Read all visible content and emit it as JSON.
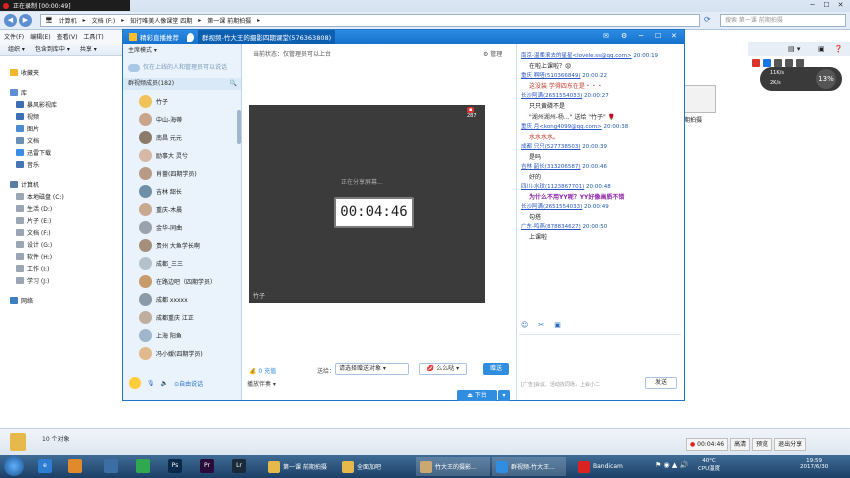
{
  "recorder": {
    "status": "正在录制 [00:00:49]"
  },
  "explorer": {
    "address": [
      "计算机",
      "文档 (F:)",
      "知行唯美人像课堂 四期",
      "第一课 前期拍摄"
    ],
    "search_placeholder": "搜索 第一课 前期拍摄",
    "menu": [
      "文件(F)",
      "编辑(E)",
      "查看(V)",
      "工具(T)"
    ],
    "toolbar": [
      "组织 ▾",
      "包含到库中 ▾",
      "共享 ▾"
    ],
    "tree": [
      {
        "label": "收藏夹",
        "icon": "star-icon",
        "indent": 0
      },
      {
        "label": "库",
        "icon": "library-icon",
        "indent": 0
      },
      {
        "label": "暴风影视库",
        "icon": "video-library-icon",
        "indent": 1
      },
      {
        "label": "视频",
        "icon": "video-icon",
        "indent": 1
      },
      {
        "label": "图片",
        "icon": "picture-icon",
        "indent": 1
      },
      {
        "label": "文档",
        "icon": "document-icon",
        "indent": 1
      },
      {
        "label": "迅雷下载",
        "icon": "download-icon",
        "indent": 1
      },
      {
        "label": "音乐",
        "icon": "music-icon",
        "indent": 1
      },
      {
        "label": "计算机",
        "icon": "computer-icon",
        "indent": 0
      },
      {
        "label": "本地磁盘 (C:)",
        "icon": "drive-icon",
        "indent": 1
      },
      {
        "label": "生活 (D:)",
        "icon": "drive-icon",
        "indent": 1
      },
      {
        "label": "片子 (E:)",
        "icon": "drive-icon",
        "indent": 1
      },
      {
        "label": "文档 (F:)",
        "icon": "drive-icon",
        "indent": 1
      },
      {
        "label": "设计 (G:)",
        "icon": "drive-icon",
        "indent": 1
      },
      {
        "label": "软件 (H:)",
        "icon": "drive-icon",
        "indent": 1
      },
      {
        "label": "工作 (I:)",
        "icon": "drive-icon",
        "indent": 1
      },
      {
        "label": "学习 (J:)",
        "icon": "drive-icon",
        "indent": 1
      },
      {
        "label": "网络",
        "icon": "network-icon",
        "indent": 0
      }
    ],
    "file_label": "前期拍摄",
    "status_count": "10 个对象"
  },
  "yy": {
    "tab1": "精彩直播推荐",
    "title": "群视频-竹大王的摄影四期课堂(576363808)",
    "mode": "主席模式 ▾",
    "notice": "仅在上线的人和管理员可以说话",
    "members_header": "群视频成员(182)",
    "members": [
      "竹子",
      "中山-海蒂",
      "南昌 元元",
      "励事大 灵兮",
      "肖蔷(四期学员)",
      "吉林 韶长",
      "重庆-木晨",
      "金华-同曲",
      "贵州 大鱼学长啊",
      "成都_三三",
      "在路边吧（四期学员）",
      "成都 xxxxx",
      "成都重庆 江正",
      "上海 阳鱼",
      "冯小嫒(四期学员)"
    ],
    "mic_status": "自由说话",
    "playlist": "播放伴奏 ▾",
    "current_state": "当前状态：仅管理员可以上台",
    "manage": "管理",
    "viewers": "287",
    "sharing_text": "正在分享屏幕...",
    "timer": "00:04:46",
    "presenter": "竹子",
    "flowers": "0  充值",
    "gift_target_label": "送给：",
    "gift_target": "请选择赠送对象",
    "gift_item": "么么哒",
    "gift_send": "赠送",
    "stage_button": "下台",
    "chat": [
      {
        "head": "南京-温柔滚去的星星<lovele.ss@qq.com>",
        "time": "20:00:19",
        "body": "在啦上课啦？😟",
        "color": "#222"
      },
      {
        "head": "重庆 啊嗒(510366849)",
        "time": "20:00:22",
        "body": "这没装 学得四东在是・・・",
        "color": "#c0392b"
      },
      {
        "head": "长沙阿满(2651554033)",
        "time": "20:00:27",
        "body": "只只黄磷不是",
        "color": "#222"
      },
      {
        "head": "",
        "time": "",
        "body": "\"湖州湖州-杨...\" 送给 \"竹子\" 🌹",
        "color": "#333"
      },
      {
        "head": "重庆 月<kong4099@qq.com>",
        "time": "20:00:38",
        "body": "水水水水。",
        "color": "#c0392b"
      },
      {
        "head": "成都 只只(527738503)",
        "time": "20:00:39",
        "body": "是吗",
        "color": "#222"
      },
      {
        "head": "吉林 韶长(313206587)",
        "time": "20:00:46",
        "body": "好的",
        "color": "#222"
      },
      {
        "head": "四川-水玟(1123867701)",
        "time": "20:00:48",
        "body": "为什么不用YY呢？YY好像画质不错",
        "color": "#8e24aa"
      },
      {
        "head": "长沙阿满(2651554033)",
        "time": "20:00:49",
        "body": "勾搭",
        "color": "#222"
      },
      {
        "head": "广东-鸣燕(878834627)",
        "time": "20:00:50",
        "body": "上课啦",
        "color": "#222"
      }
    ],
    "chat_input_hint": "[广告]会议、活动找同场，上会小二",
    "send_button": "发送"
  },
  "floating": {
    "speed_percent": "13%",
    "speed_up": "11K/s",
    "speed_down": "2K/s"
  },
  "record_panel": {
    "time": "00:04:46",
    "buttons": [
      "高清",
      "预览",
      "退出分享"
    ]
  },
  "taskbar": {
    "items": [
      "第一课 前期拍摄",
      "全面加吧",
      "竹大王的摄影...",
      "群视频-竹大王...",
      "Bandicam"
    ],
    "temp": "40°C",
    "temp_label": "CPU温度",
    "time": "19:59",
    "date": "2017/6/30"
  }
}
